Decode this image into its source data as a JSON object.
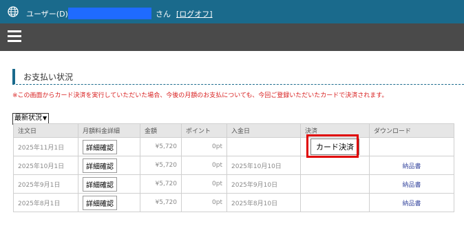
{
  "header": {
    "user_label": "ユーザー(D):",
    "honorific": "さん",
    "logout_label": "[ログオフ]",
    "user_box_color": "#1f6bff"
  },
  "page": {
    "section_title": "お支払い状況",
    "notice": "※この画面からカード決済を実行していただいた場合、今後の月額のお支払についても、今回ご登録いただいたカードで決済されます。",
    "filter_selected": "最新状況"
  },
  "table": {
    "headers": [
      "注文日",
      "月額料金詳細",
      "金額",
      "ポイント",
      "入金日",
      "決済",
      "ダウンロード"
    ],
    "detail_label": "詳細確認",
    "card_label": "カード決済",
    "rows": [
      {
        "order_date": "2025年11月1日",
        "amount": "¥5,720",
        "points": "0pt",
        "payment_date": "",
        "download": ""
      },
      {
        "order_date": "2025年10月1日",
        "amount": "¥5,720",
        "points": "0pt",
        "payment_date": "2025年10月10日",
        "download": "納品書"
      },
      {
        "order_date": "2025年9月1日",
        "amount": "¥5,720",
        "points": "0pt",
        "payment_date": "2025年9月10日",
        "download": "納品書"
      },
      {
        "order_date": "2025年8月1日",
        "amount": "¥5,720",
        "points": "0pt",
        "payment_date": "2025年8月10日",
        "download": "納品書"
      }
    ]
  },
  "icons": {
    "globe": "globe-icon",
    "menu": "hamburger-menu-icon",
    "dropdown": "chevron-down-icon"
  },
  "colors": {
    "topbar": "#1a6a8c",
    "navbar": "#4a4a4a",
    "notice": "#d81e1e",
    "highlight": "#e00000",
    "link": "#3a4aa0"
  }
}
